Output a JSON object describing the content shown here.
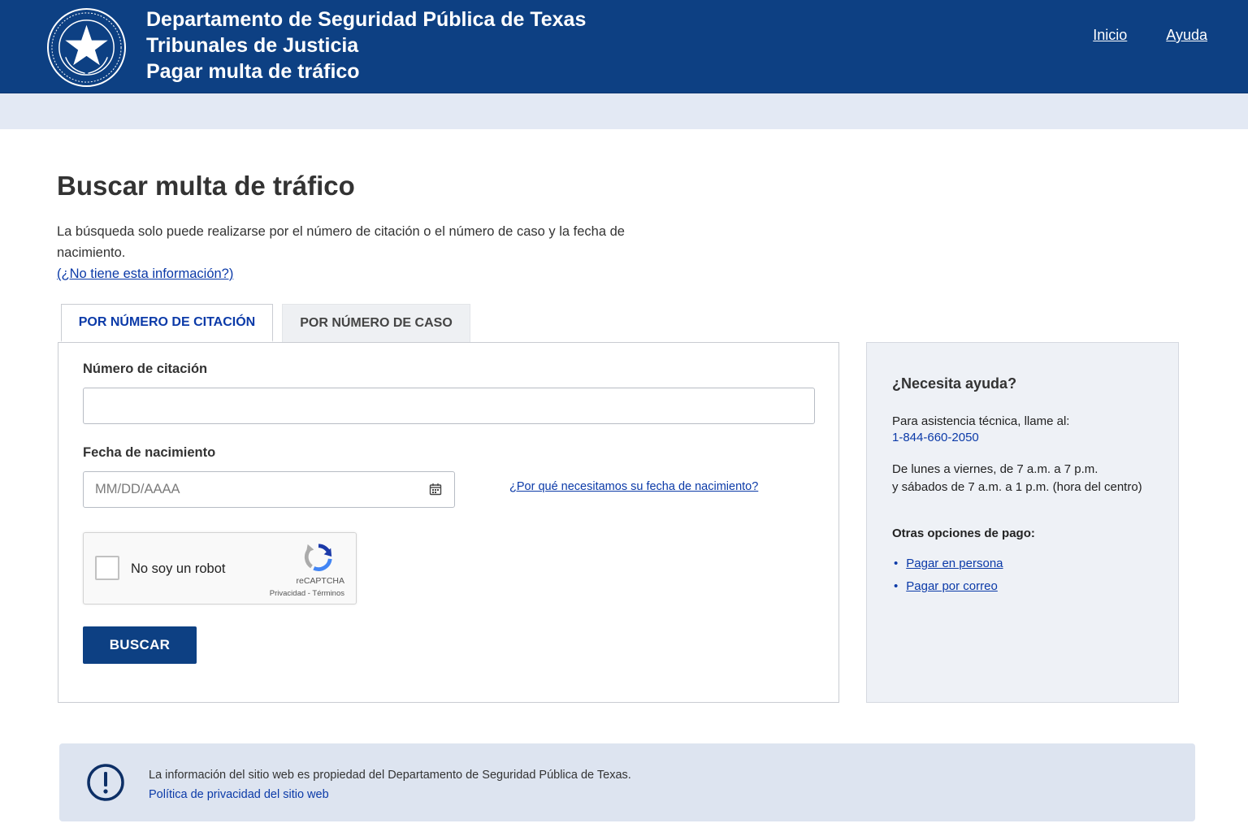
{
  "header": {
    "line1": "Departamento de Seguridad Pública de Texas",
    "line2": "Tribunales de Justicia",
    "line3": "Pagar multa de tráfico",
    "nav": [
      "Inicio",
      "Ayuda"
    ]
  },
  "main": {
    "title": "Buscar multa de tráfico",
    "intro": "La búsqueda solo puede realizarse por el número de citación o el número de caso y la fecha de nacimiento.",
    "intro_link": "(¿No tiene esta información?)",
    "tabs": [
      {
        "label": "POR NÚMERO DE CITACIÓN",
        "active": true
      },
      {
        "label": "POR NÚMERO DE CASO",
        "active": false
      }
    ]
  },
  "form": {
    "citation_label": "Número de citación",
    "citation_value": "",
    "dob_label": "Fecha de nacimiento",
    "dob_placeholder": "MM/DD/AAAA",
    "why_link": "¿Por qué necesitamos su fecha de nacimiento?",
    "captcha_text": "No soy un robot",
    "captcha_brand": "reCAPTCHA",
    "captcha_links": "Privacidad - Términos",
    "search_button": "BUSCAR"
  },
  "help": {
    "title": "¿Necesita ayuda?",
    "tech_text": "Para asistencia técnica, llame al:",
    "phone": "1-844-660-2050",
    "hours_line1": "De lunes a viernes, de 7 a.m. a 7 p.m.",
    "hours_line2": "y sábados de 7 a.m. a 1 p.m. (hora del centro)",
    "other_title": "Otras opciones de pago:",
    "options": [
      "Pagar en persona",
      "Pagar por correo"
    ]
  },
  "notice": {
    "text": "La información del sitio web es propiedad del Departamento de Seguridad Pública de Texas.",
    "link": "Política de privacidad del sitio web",
    "icon": "exclamation-circle-icon"
  },
  "colors": {
    "header_bg": "#0d4083",
    "band_bg": "#e3e9f4",
    "link": "#0b3aa8",
    "help_bg": "#eef1f6",
    "notice_bg": "#dde4f0"
  }
}
